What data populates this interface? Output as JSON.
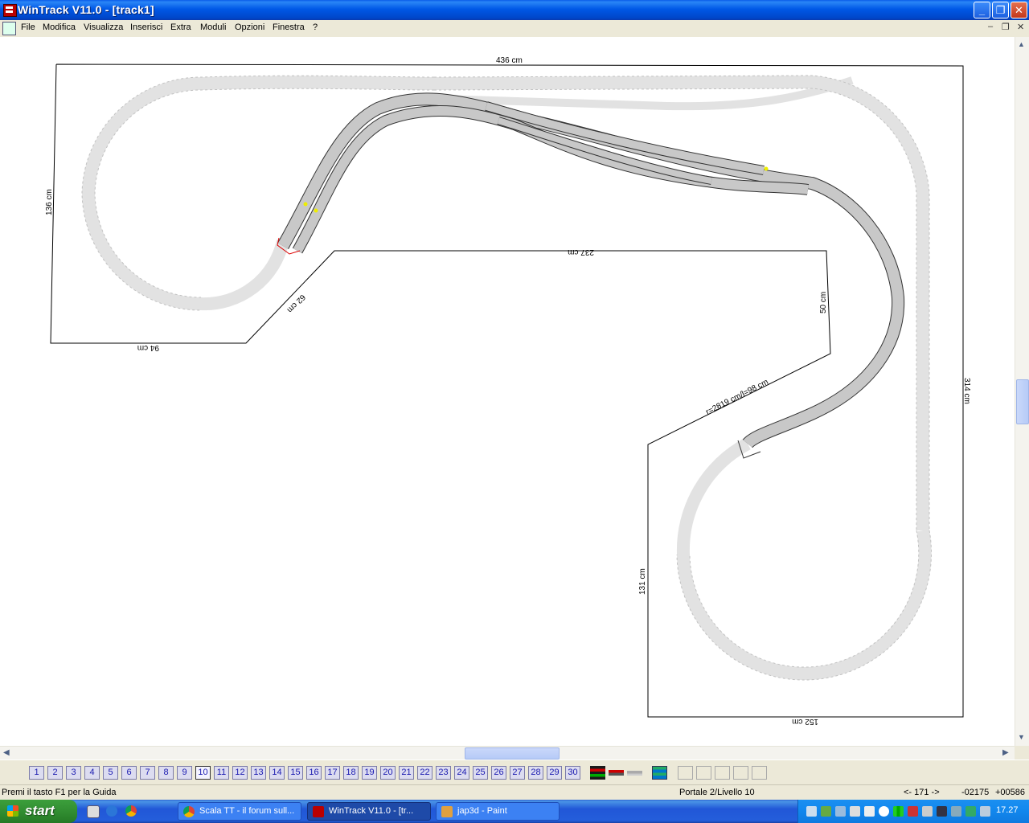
{
  "window": {
    "title": "WinTrack  V11.0 - [track1]"
  },
  "menu": [
    "File",
    "Modifica",
    "Visualizza",
    "Inserisci",
    "Extra",
    "Moduli",
    "Opzioni",
    "Finestra",
    "?"
  ],
  "dimensions": {
    "top": "436 cm",
    "left": "136 cm",
    "inner_top": "237 cm",
    "diag_left": "62 cm",
    "bottom_left": "94 cm",
    "inner_right": "50 cm",
    "diag_right": "r=2819 cm/l=98 cm",
    "right": "314 cm",
    "lower_left": "131 cm",
    "bottom": "152 cm"
  },
  "levels": [
    "1",
    "2",
    "3",
    "4",
    "5",
    "6",
    "7",
    "8",
    "9",
    "10",
    "11",
    "12",
    "13",
    "14",
    "15",
    "16",
    "17",
    "18",
    "19",
    "20",
    "21",
    "22",
    "23",
    "24",
    "25",
    "26",
    "27",
    "28",
    "29",
    "30"
  ],
  "status": {
    "help": "Premi il tasto F1 per la Guida",
    "level": "Portale 2/Livello 10",
    "nav": "<- 171 ->",
    "x": "-02175",
    "y": "+00586"
  },
  "taskbar": {
    "start": "start",
    "tasks": [
      "Scala TT - il forum sull...",
      "WinTrack  V11.0 - [tr...",
      "jap3d - Paint"
    ],
    "clock": "17.27"
  },
  "colors": {
    "track_active": "#c8c8c8",
    "track_ghost": "#e6e6e6",
    "titlebar": "#0058e6",
    "taskbar": "#245edb"
  }
}
